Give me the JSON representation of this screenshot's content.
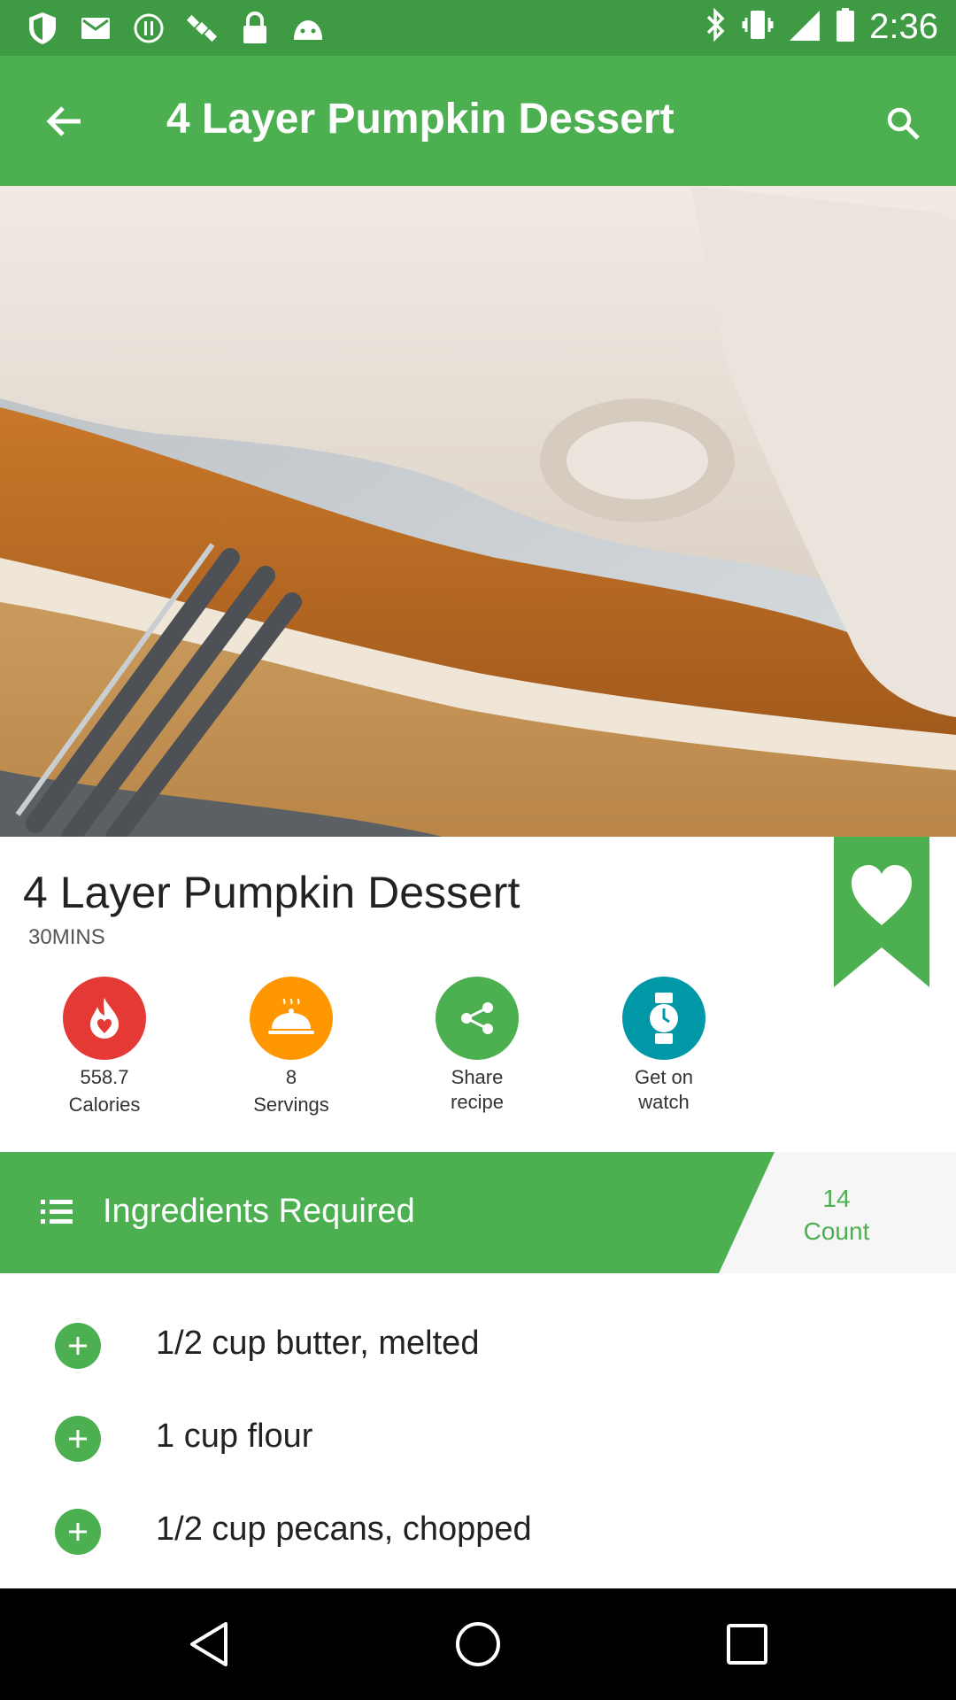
{
  "status_bar": {
    "time": "2:36",
    "icons": [
      "shield-icon",
      "mail-icon",
      "info-icon",
      "satellite-icon",
      "lock-icon",
      "android-icon"
    ],
    "right_icons": [
      "bluetooth-icon",
      "vibrate-icon",
      "signal-icon",
      "battery-icon"
    ]
  },
  "app_bar": {
    "title": "4 Layer Pumpkin Dessert",
    "back_icon": "arrow-back-icon",
    "search_icon": "search-icon"
  },
  "recipe": {
    "title": "4 Layer Pumpkin Dessert",
    "time": "30MINS",
    "hero_image": "pumpkin-dessert-photo",
    "favorite_icon": "heart-bookmark-icon"
  },
  "actions": [
    {
      "line1": "558.7",
      "line2": "Calories",
      "icon": "flame-icon",
      "color": "#e53935"
    },
    {
      "line1": "8",
      "line2": "Servings",
      "icon": "dish-cloche-icon",
      "color": "#ff9800"
    },
    {
      "line1": "Share",
      "line2": "recipe",
      "icon": "share-icon",
      "color": "#4caf50"
    },
    {
      "line1": "Get on",
      "line2": "watch",
      "icon": "watch-icon",
      "color": "#0097a7"
    }
  ],
  "ingredients": {
    "header": "Ingredients Required",
    "count_value": "14",
    "count_label": "Count",
    "items": [
      {
        "text": "1/2 cup butter, melted"
      },
      {
        "text": "1 cup flour"
      },
      {
        "text": "1/2 cup pecans, chopped"
      }
    ]
  },
  "colors": {
    "status_bar": "#3e9b44",
    "primary": "#4caf50",
    "text": "#222222"
  },
  "nav_bar": {
    "icons": [
      "back-triangle-icon",
      "home-circle-icon",
      "recents-square-icon"
    ]
  }
}
